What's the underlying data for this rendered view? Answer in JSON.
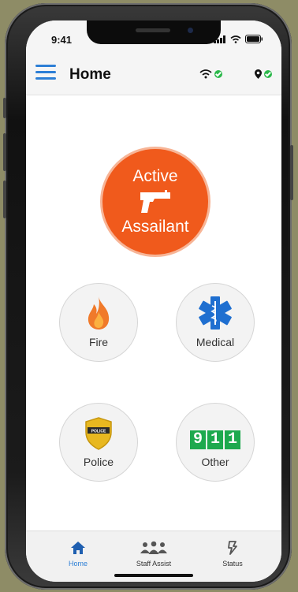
{
  "status_bar": {
    "time": "9:41"
  },
  "header": {
    "title": "Home"
  },
  "primary_action": {
    "line1": "Active",
    "line2": "Assailant",
    "color": "#f05a1c",
    "icon": "gun-icon"
  },
  "emergency_buttons": [
    {
      "label": "Fire",
      "icon": "fire-icon"
    },
    {
      "label": "Medical",
      "icon": "star-of-life-icon"
    },
    {
      "label": "Police",
      "icon": "police-badge-icon",
      "badge_text": "POLICE"
    },
    {
      "label": "Other",
      "icon": "911-icon",
      "digits": [
        "9",
        "1",
        "1"
      ]
    }
  ],
  "tabs": [
    {
      "label": "Home",
      "icon": "home-icon",
      "active": true
    },
    {
      "label": "Staff Assist",
      "icon": "staff-group-icon",
      "active": false
    },
    {
      "label": "Status",
      "icon": "status-icon",
      "active": false
    }
  ],
  "colors": {
    "accent": "#2d7fd6",
    "ok": "#2bb84a",
    "fire": "#f07a2a",
    "medical": "#1f6fd0",
    "police": "#e8b820",
    "green911": "#1da94e"
  }
}
